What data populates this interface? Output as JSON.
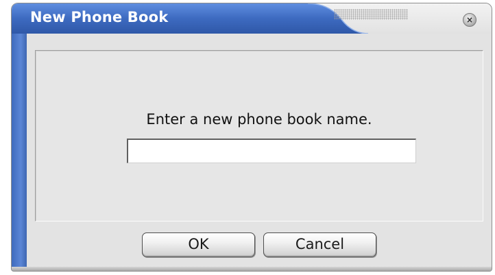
{
  "window": {
    "title": "New Phone Book"
  },
  "dialog": {
    "prompt": "Enter a new phone book name.",
    "name_input": {
      "value": "",
      "placeholder": ""
    },
    "ok_label": "OK",
    "cancel_label": "Cancel"
  },
  "icons": {
    "close": "close-icon"
  },
  "colors": {
    "title_blue": "#3c6bc2",
    "title_text": "#ffffff",
    "panel_bg": "#e6e6e6"
  }
}
